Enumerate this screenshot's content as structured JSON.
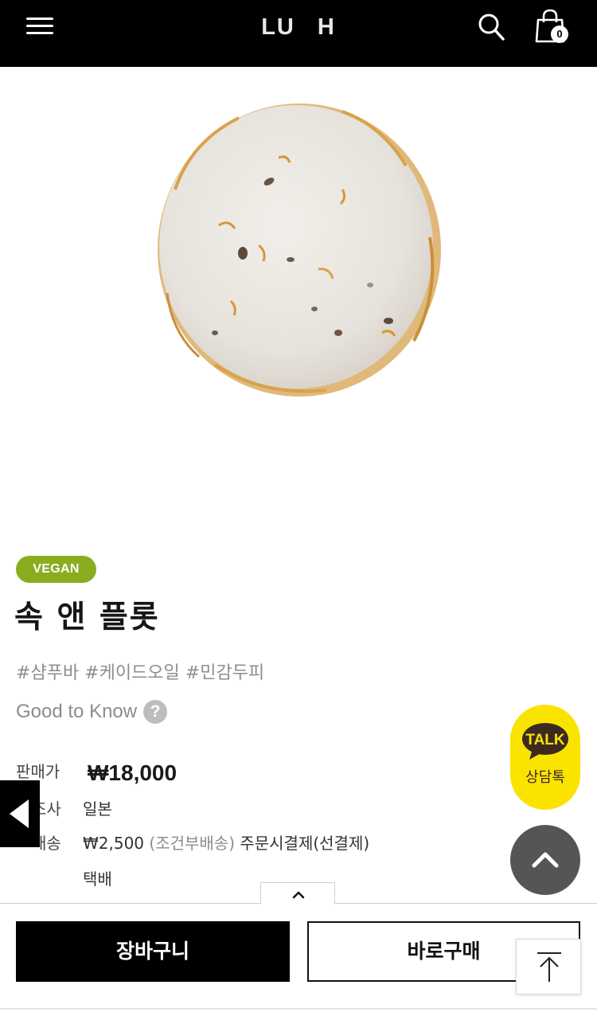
{
  "header": {
    "logo_left": "LU",
    "logo_right": "H",
    "cart_count": "0",
    "background": "#000000"
  },
  "product": {
    "image_icon": "shampoo-bar-image",
    "badge": "VEGAN",
    "badge_color": "#8aad1f",
    "name": "속 앤 플롯",
    "hashtags": "#샴푸바 #케이드오일 #민감두피",
    "good_to_know": "Good to Know",
    "help_symbol": "?"
  },
  "details": {
    "price_label": "판매가",
    "price": "₩18,000",
    "origin_label": "조사",
    "origin": "일본",
    "shipping_label": "배송",
    "shipping_fee": "₩2,500",
    "shipping_condition": "(조건부배송)",
    "shipping_payment": "주문시결제(선결제)",
    "shipping_method": "택배"
  },
  "talk": {
    "bubble_text": "TALK",
    "label": "상담톡",
    "color": "#fbe300"
  },
  "bottom": {
    "add_to_cart": "장바구니",
    "buy_now": "바로구매"
  }
}
